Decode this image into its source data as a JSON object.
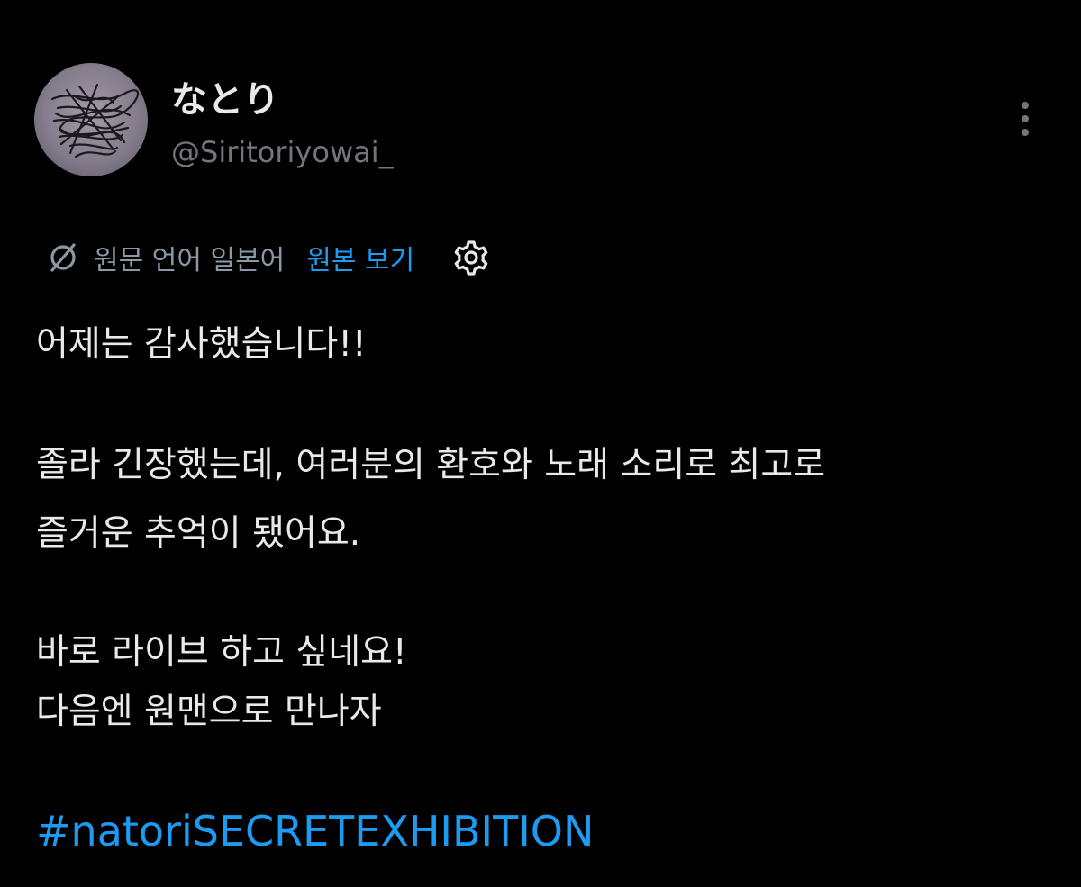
{
  "author": {
    "display_name": "なとり",
    "username": "@Siritoriyowai_"
  },
  "translation": {
    "source_language_text": "원문 언어 일본어",
    "view_original_label": "원본 보기"
  },
  "tweet": {
    "lines": [
      "어제는 감사했습니다!!",
      "졸라 긴장했는데, 여러분의 환호와 노래 소리로 최고로",
      "즐거운 추억이 됐어요.",
      "바로 라이브 하고 싶네요!",
      "다음엔 원맨으로 만나자"
    ],
    "hashtag": "#natoriSECRETEXHIBITION"
  },
  "icons": {
    "more": "more-vertical-icon",
    "translate": "translate-icon",
    "settings": "gear-icon"
  },
  "colors": {
    "background": "#000000",
    "text_primary": "#e7e9ea",
    "text_secondary": "#71767b",
    "accent": "#1d9bf0"
  }
}
